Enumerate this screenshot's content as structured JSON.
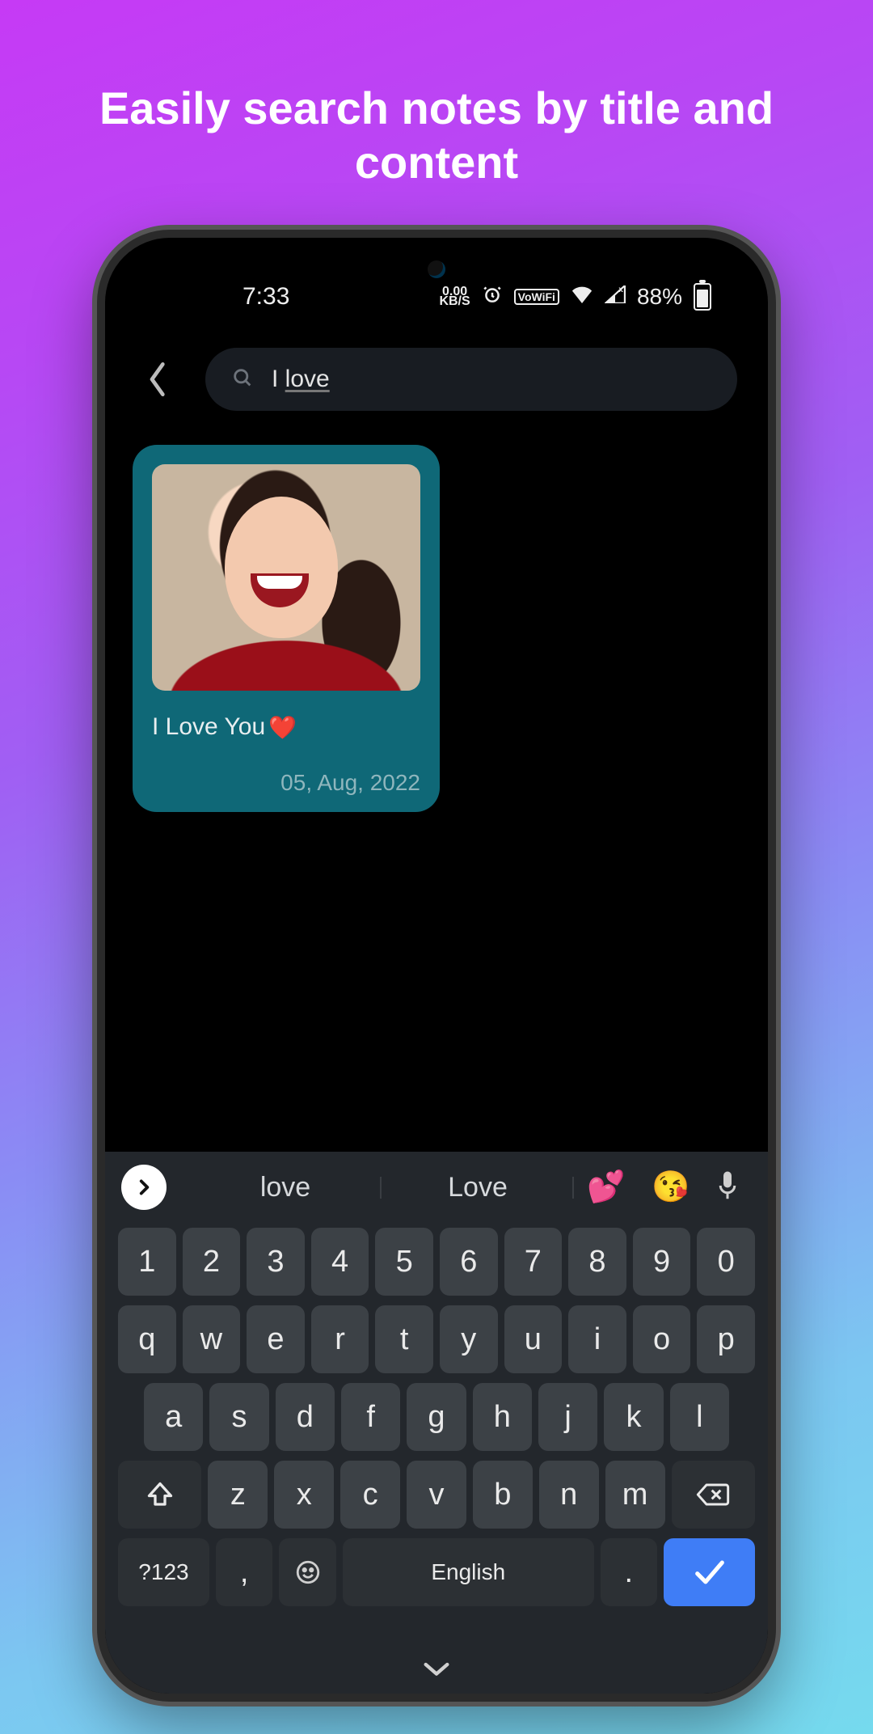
{
  "promo": {
    "headline": "Easily search notes by title and content"
  },
  "status": {
    "time": "7:33",
    "net_top": "0.00",
    "net_bot": "KB/S",
    "vowifi": "VoWiFi",
    "battery_pct": "88%"
  },
  "search": {
    "query_prefix": "I ",
    "query_underlined": "love"
  },
  "note": {
    "title": "I Love You",
    "heart": "❤️",
    "date": "05, Aug, 2022"
  },
  "keyboard": {
    "suggestions": [
      "love",
      "Love"
    ],
    "sugg_emoji": [
      "💕",
      "😘"
    ],
    "row_num": [
      "1",
      "2",
      "3",
      "4",
      "5",
      "6",
      "7",
      "8",
      "9",
      "0"
    ],
    "row1": [
      "q",
      "w",
      "e",
      "r",
      "t",
      "y",
      "u",
      "i",
      "o",
      "p"
    ],
    "row2": [
      "a",
      "s",
      "d",
      "f",
      "g",
      "h",
      "j",
      "k",
      "l"
    ],
    "row3": [
      "z",
      "x",
      "c",
      "v",
      "b",
      "n",
      "m"
    ],
    "sym_key": "?123",
    "comma": ",",
    "space_label": "English",
    "period": "."
  }
}
